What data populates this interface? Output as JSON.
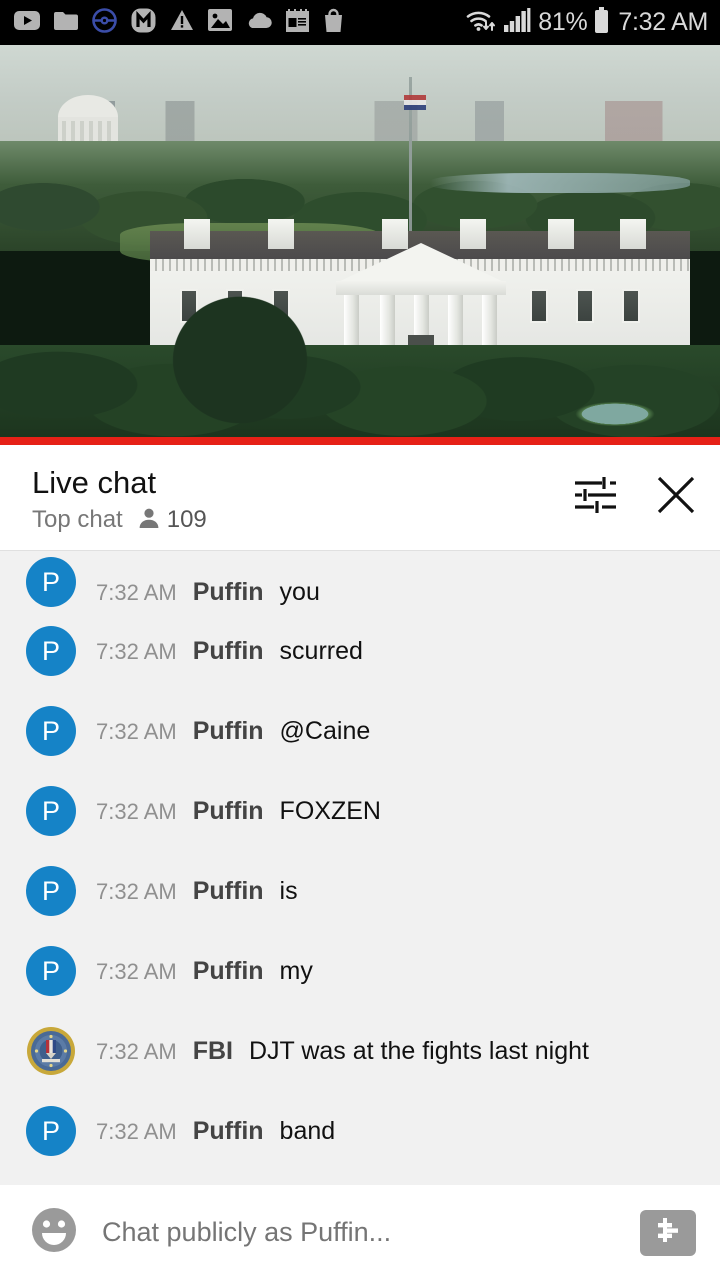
{
  "status_bar": {
    "icons_left": [
      "youtube-play-icon",
      "folder-icon",
      "pokeball-icon",
      "messenger-m-icon",
      "warning-triangle-icon",
      "photo-icon",
      "cloud-icon",
      "notepad-icon",
      "shopping-bag-icon"
    ],
    "wifi_icon": "wifi-data-transfer-icon",
    "signal_icon": "cellular-signal-icon",
    "battery_percent": "81%",
    "battery_icon": "battery-icon",
    "clock": "7:32 AM",
    "background_color": "#000000",
    "text_color": "#d9d9d9"
  },
  "video": {
    "scene_description": "White House north facade live stream",
    "progress_percent": 100,
    "progress_color": "#e62117"
  },
  "chat_header": {
    "title": "Live chat",
    "mode": "Top chat",
    "viewer_icon": "person-icon",
    "viewer_count": "109",
    "settings_icon": "chat-settings-sliders-icon",
    "close_icon": "close-icon"
  },
  "chat_messages": [
    {
      "avatar_letter": "P",
      "avatar_type": "puffin",
      "time": "7:32 AM",
      "author": "Puffin",
      "text": "you"
    },
    {
      "avatar_letter": "P",
      "avatar_type": "puffin",
      "time": "7:32 AM",
      "author": "Puffin",
      "text": "scurred"
    },
    {
      "avatar_letter": "P",
      "avatar_type": "puffin",
      "time": "7:32 AM",
      "author": "Puffin",
      "text": "@Caine"
    },
    {
      "avatar_letter": "P",
      "avatar_type": "puffin",
      "time": "7:32 AM",
      "author": "Puffin",
      "text": "FOXZEN"
    },
    {
      "avatar_letter": "P",
      "avatar_type": "puffin",
      "time": "7:32 AM",
      "author": "Puffin",
      "text": "is"
    },
    {
      "avatar_letter": "P",
      "avatar_type": "puffin",
      "time": "7:32 AM",
      "author": "Puffin",
      "text": "my"
    },
    {
      "avatar_letter": "",
      "avatar_type": "fbi-seal",
      "time": "7:32 AM",
      "author": "FBI",
      "text": "DJT was at the fights last night"
    },
    {
      "avatar_letter": "P",
      "avatar_type": "puffin",
      "time": "7:32 AM",
      "author": "Puffin",
      "text": "band"
    }
  ],
  "chat_input": {
    "emoji_icon": "emoji-smiley-icon",
    "placeholder": "Chat publicly as Puffin...",
    "super_chat_icon": "dollar-sign-icon"
  },
  "colors": {
    "avatar_blue": "#1583c7",
    "chat_background": "#f1f1f1",
    "progress_red": "#e62117"
  }
}
